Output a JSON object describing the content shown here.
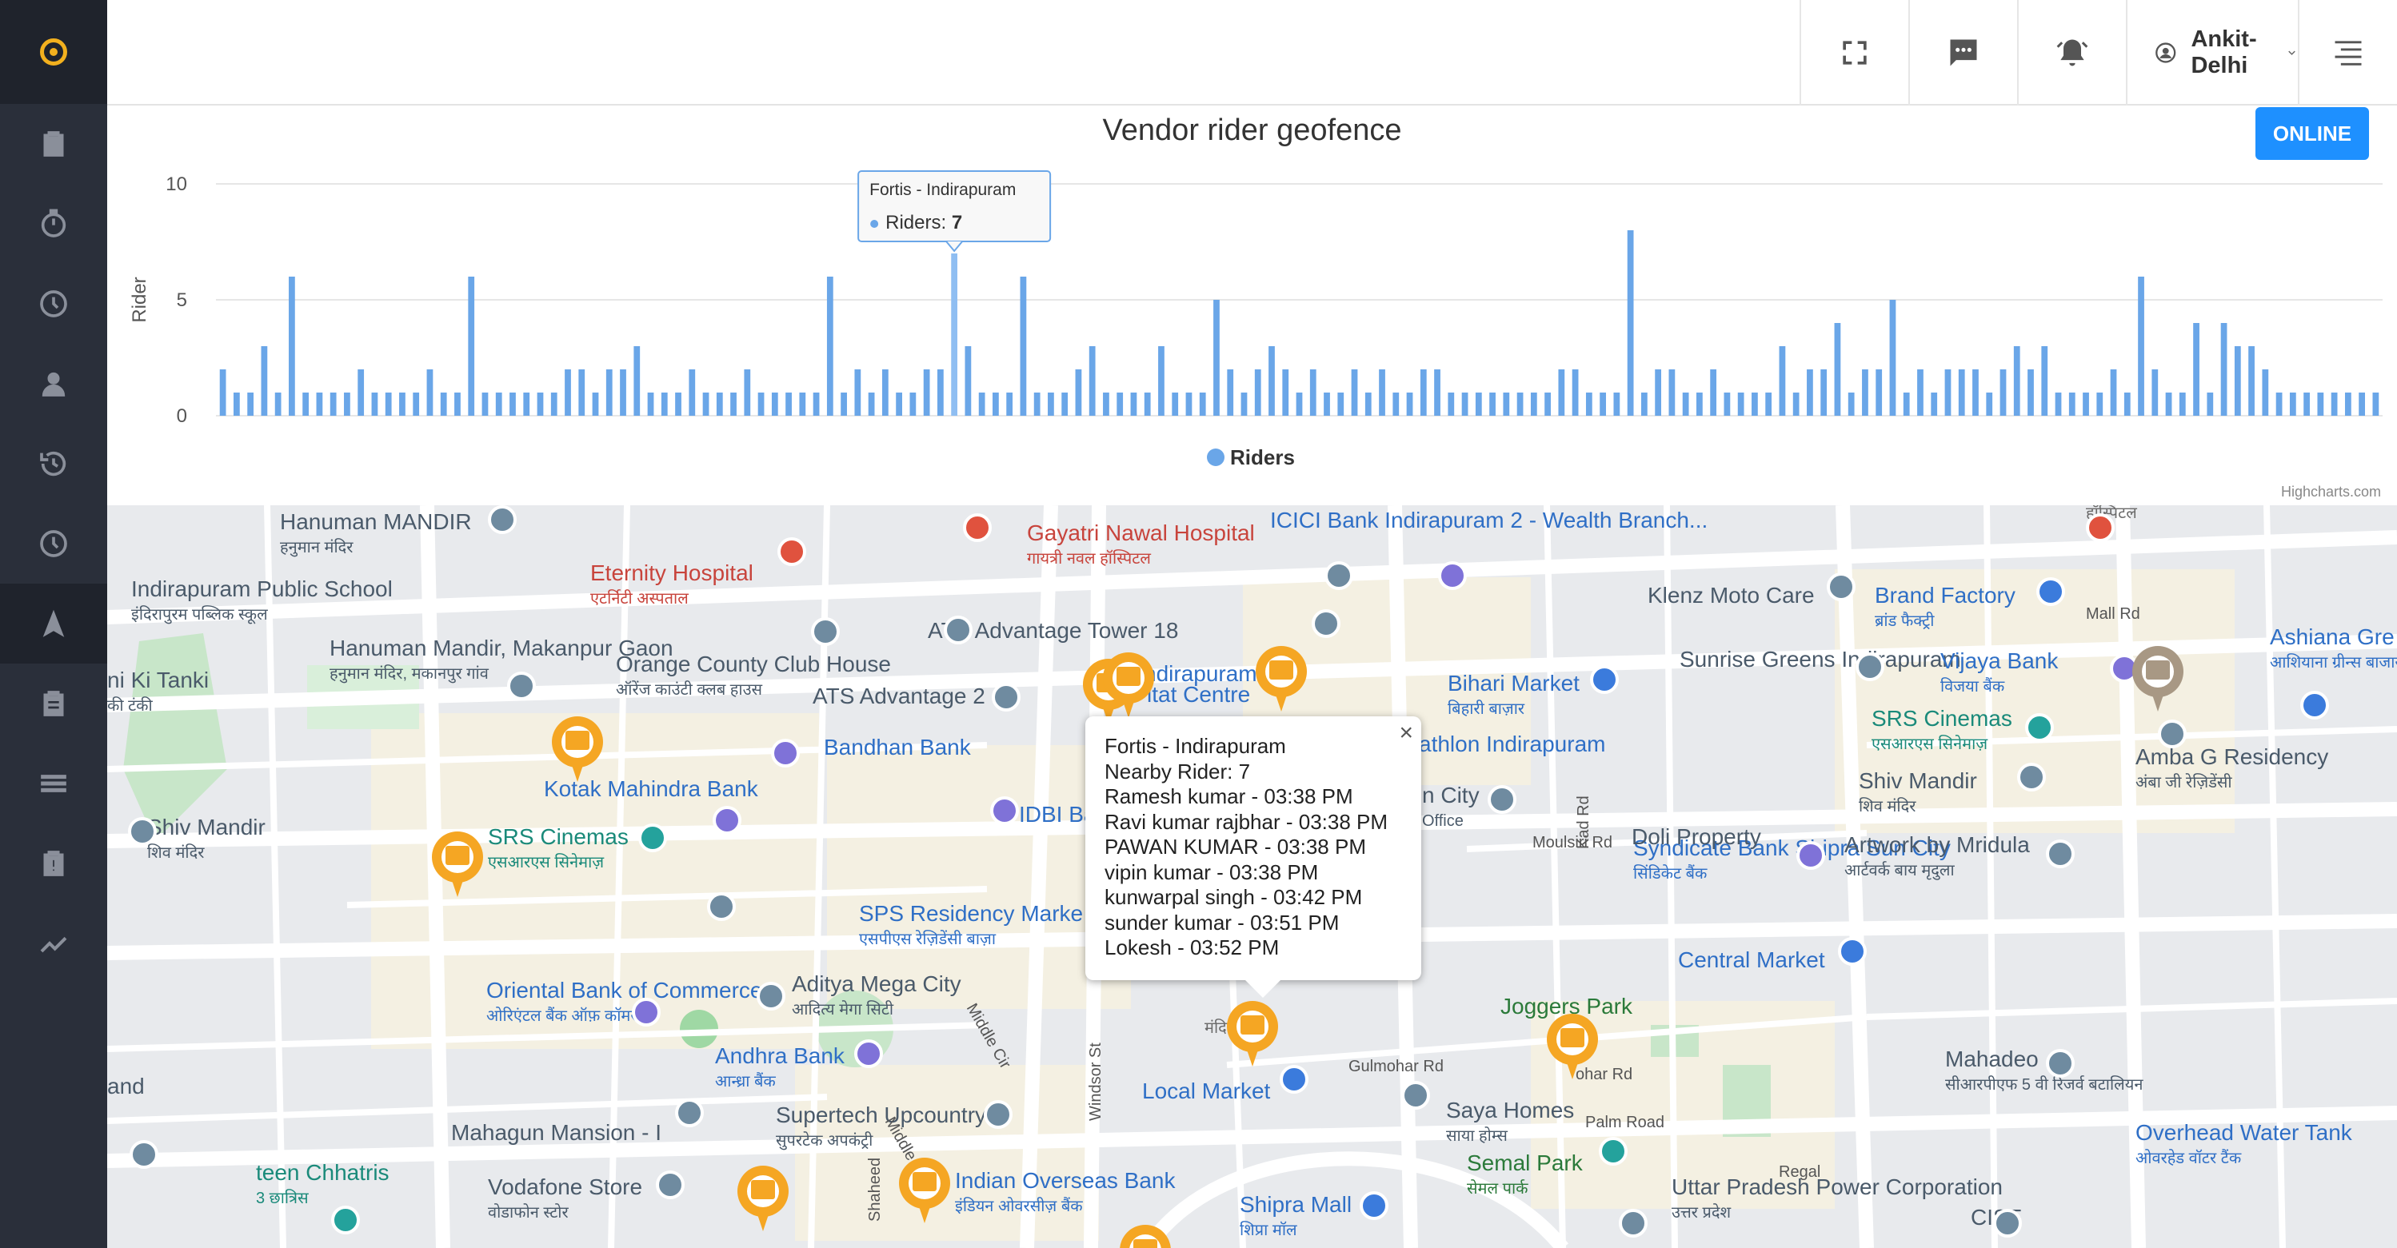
{
  "topbar": {
    "user_label": "Ankit- Delhi"
  },
  "sidebar": {
    "items": [
      {
        "icon": "clipboard-icon"
      },
      {
        "icon": "stopwatch-icon"
      },
      {
        "icon": "clock-icon"
      },
      {
        "icon": "user-icon"
      },
      {
        "icon": "history-icon"
      },
      {
        "icon": "clock-icon"
      },
      {
        "icon": "navigation-arrow-icon",
        "active": true
      },
      {
        "icon": "clipboard-list-icon"
      },
      {
        "icon": "menu-lines-icon"
      },
      {
        "icon": "clipboard-alert-icon"
      },
      {
        "icon": "trend-line-icon"
      }
    ]
  },
  "status_button": "ONLINE",
  "colors": {
    "accent": "#1e90ff",
    "bar": "#6aa6e8",
    "pin": "#f5a623",
    "sidebar": "#2a2f3a"
  },
  "chart_data": {
    "type": "bar",
    "title": "Vendor rider geofence",
    "ylabel": "Rider",
    "ylim": [
      0,
      10
    ],
    "yticks": [
      0,
      5,
      10
    ],
    "series": [
      {
        "name": "Riders",
        "values": [
          2,
          1,
          1,
          3,
          1,
          6,
          1,
          1,
          1,
          1,
          2,
          1,
          1,
          1,
          1,
          2,
          1,
          1,
          6,
          1,
          1,
          1,
          1,
          1,
          1,
          2,
          2,
          1,
          2,
          2,
          3,
          1,
          1,
          1,
          2,
          1,
          1,
          1,
          2,
          1,
          1,
          1,
          1,
          1,
          6,
          1,
          2,
          1,
          2,
          1,
          1,
          2,
          2,
          7,
          3,
          1,
          1,
          1,
          6,
          1,
          1,
          1,
          2,
          3,
          1,
          1,
          1,
          1,
          3,
          1,
          1,
          1,
          5,
          2,
          1,
          2,
          3,
          2,
          1,
          2,
          1,
          1,
          2,
          1,
          2,
          1,
          1,
          2,
          2,
          1,
          1,
          1,
          1,
          1,
          1,
          1,
          1,
          2,
          2,
          1,
          1,
          1,
          8,
          1,
          2,
          2,
          1,
          1,
          2,
          1,
          1,
          1,
          1,
          3,
          1,
          2,
          2,
          4,
          1,
          2,
          2,
          5,
          1,
          2,
          1,
          2,
          2,
          2,
          1,
          2,
          3,
          2,
          3,
          1,
          1,
          1,
          1,
          2,
          1,
          6,
          2,
          1,
          1,
          4,
          1,
          4,
          3,
          3,
          2,
          1,
          1,
          1,
          1,
          1,
          1,
          1,
          1
        ]
      }
    ],
    "tooltip": {
      "category": "Fortis - Indirapuram",
      "series": "Riders",
      "value": 7,
      "index": 53
    },
    "legend": {
      "label": "Riders",
      "position": "bottom-center"
    },
    "credit": "Highcharts.com"
  },
  "popup": {
    "title": "Fortis - Indirapuram",
    "nearby": "Nearby Rider: 7",
    "riders": [
      "Ramesh kumar - 03:38 PM",
      "Ravi kumar rajbhar - 03:38 PM",
      "PAWAN KUMAR - 03:38 PM",
      "vipin kumar - 03:38 PM",
      "kunwarpal singh - 03:42 PM",
      "sunder kumar - 03:51 PM",
      "Lokesh - 03:52 PM"
    ]
  },
  "map_labels": [
    {
      "text": "Hanuman MANDIR",
      "sub": "हनुमान मंदिर",
      "cls": ""
    },
    {
      "text": "Gayatri Nawal Hospital",
      "sub": "गायत्री नवल हॉस्पिटल",
      "cls": "red"
    },
    {
      "text": "ICICI Bank Indirapuram 2 - Wealth Branch...",
      "cls": "blue"
    },
    {
      "text": "Indirapuram Public School",
      "sub": "इंदिरापुरम पब्लिक स्कूल",
      "cls": ""
    },
    {
      "text": "Eternity Hospital",
      "sub": "एटर्निटी अस्पताल",
      "cls": "red"
    },
    {
      "text": "Klenz Moto Care",
      "cls": ""
    },
    {
      "text": "Brand Factory",
      "sub": "ब्रांड फैक्ट्री",
      "cls": "blue"
    },
    {
      "text": "Ashiana Gre",
      "sub": "आशियाना ग्रीन्स बाजार",
      "cls": "blue"
    },
    {
      "text": "ATS Advantage Tower 18",
      "cls": ""
    },
    {
      "text": "Hanuman Mandir, Makanpur Gaon",
      "sub": "हनुमान मंदिर, मकानपुर गांव",
      "cls": ""
    },
    {
      "text": "Orange County Club House",
      "sub": "ऑरेंज काउंटी क्लब हाउस",
      "cls": ""
    },
    {
      "text": "ATS Advantage 2",
      "cls": ""
    },
    {
      "text": "ndirapuram",
      "cls": "blue"
    },
    {
      "text": "itat Centre",
      "cls": "blue"
    },
    {
      "text": "Bihari Market",
      "sub": "बिहारी बाज़ार",
      "cls": "blue"
    },
    {
      "text": "Sunrise Greens Indirapuram",
      "cls": ""
    },
    {
      "text": "Vijaya Bank",
      "sub": "विजया बैंक",
      "cls": "blue"
    },
    {
      "text": "ni Ki Tanki",
      "sub": "की टंकी",
      "cls": ""
    },
    {
      "text": "Bandhan Bank",
      "cls": "blue"
    },
    {
      "text": "athlon Indirapuram",
      "cls": "blue"
    },
    {
      "text": "SRS Cinemas",
      "sub": "एसआरएस सिनेमाज़",
      "cls": "teal"
    },
    {
      "text": "Amba G Residency",
      "sub": "अंबा जी रेज़िडेंसी",
      "cls": ""
    },
    {
      "text": "Kotak Mahindra Bank",
      "cls": "blue"
    },
    {
      "text": "IDBI Ba",
      "cls": "blue"
    },
    {
      "text": "n City",
      "sub": "Office",
      "cls": ""
    },
    {
      "text": "Shiv Mandir",
      "sub": "शिव मंदिर",
      "cls": ""
    },
    {
      "text": "Shiv Mandir",
      "sub": "शिव मंदिर",
      "cls": ""
    },
    {
      "text": "SRS Cinemas",
      "sub": "एसआरएस सिनेमाज़",
      "cls": "teal"
    },
    {
      "text": "Moulsiri Rd",
      "cls": "road"
    },
    {
      "text": "Syndicate Bank Shipra Sun City",
      "sub": "सिंडिकेट बैंक",
      "cls": "blue"
    },
    {
      "text": "Artwork by Mridula",
      "sub": "आर्टवर्क बाय मृदुला",
      "cls": ""
    },
    {
      "text": "Doli Property",
      "cls": ""
    },
    {
      "text": "SPS Residency Marke",
      "sub": "एसपीएस रेज़िडेंसी बाज़ा",
      "cls": "blue"
    },
    {
      "text": "Kad Rd",
      "cls": "road"
    },
    {
      "text": "Central Market",
      "cls": "blue"
    },
    {
      "text": "Oriental Bank of Commerce",
      "sub": "ओरिएंटल बैंक ऑफ़ कॉमर्स",
      "cls": "blue"
    },
    {
      "text": "Aditya Mega City",
      "sub": "आदित्य मेगा सिटी",
      "cls": ""
    },
    {
      "text": "Middle Cir",
      "cls": "road"
    },
    {
      "text": "Joggers Park",
      "cls": "green"
    },
    {
      "text": "Andhra Bank",
      "sub": "आन्ध्रा बैंक",
      "cls": "blue"
    },
    {
      "text": "Mahadeo",
      "sub": "सीआरपीएफ 5 वी रिजर्व बटालियन",
      "cls": ""
    },
    {
      "text": "and",
      "cls": ""
    },
    {
      "text": "Gulmohar Rd",
      "cls": "road"
    },
    {
      "text": "ohar Rd",
      "cls": "road"
    },
    {
      "text": "Local Market",
      "cls": "blue"
    },
    {
      "text": "Supertech Upcountry",
      "sub": "सुपरटेक अपकंट्री",
      "cls": ""
    },
    {
      "text": "Windsor St",
      "cls": "road"
    },
    {
      "text": "Saya Homes",
      "sub": "साया होम्स",
      "cls": ""
    },
    {
      "text": "Palm Road",
      "cls": "road"
    },
    {
      "text": "Mahagun Mansion - I",
      "cls": ""
    },
    {
      "text": "Middle Cir",
      "cls": "road"
    },
    {
      "text": "Overhead Water Tank",
      "sub": "ओवरहेड वॉटर टैंक",
      "cls": "blue"
    },
    {
      "text": "Semal Park",
      "sub": "सेमल पार्क",
      "cls": "green"
    },
    {
      "text": "Regal",
      "cls": "road"
    },
    {
      "text": "teen Chhatris",
      "sub": "3 छात्रिस",
      "cls": "teal"
    },
    {
      "text": "Vodafone Store",
      "sub": "वोडाफोन स्टोर",
      "cls": ""
    },
    {
      "text": "Indian Overseas Bank",
      "sub": "इंडियन ओवरसीज़ बैंक",
      "cls": "blue"
    },
    {
      "text": "Uttar Pradesh Power Corporation",
      "sub": "उत्तर प्रदेश",
      "cls": ""
    },
    {
      "text": "Shipra Mall",
      "sub": "शिप्रा मॉल",
      "cls": "blue"
    },
    {
      "text": "CISF",
      "cls": ""
    },
    {
      "text": "Mall Rd",
      "cls": "road"
    },
    {
      "text": "Shaheed",
      "cls": "road"
    },
    {
      "text": "मंदिर",
      "cls": "small"
    },
    {
      "text": "हॉस्पिटल",
      "cls": "small"
    }
  ]
}
